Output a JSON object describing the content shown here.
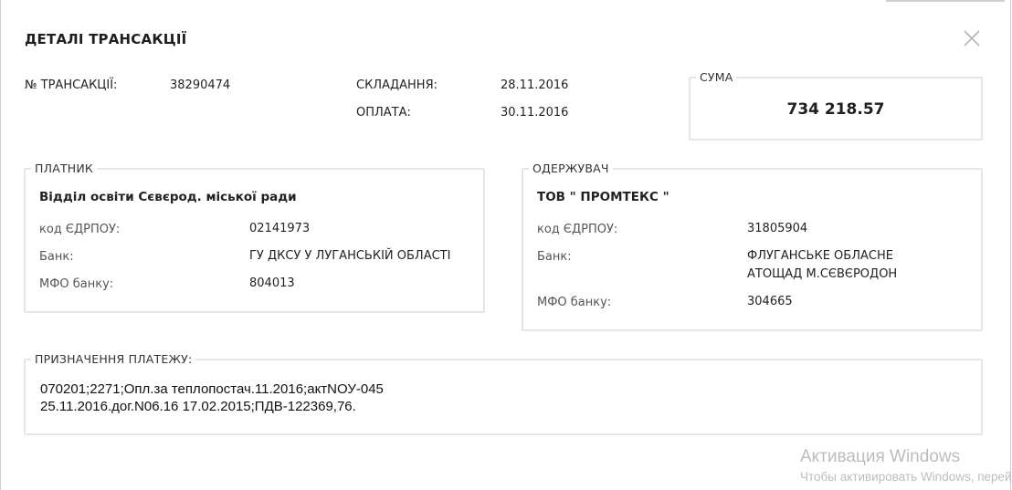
{
  "dialog": {
    "title": "ДЕТАЛІ ТРАНСАКЦІЇ"
  },
  "transaction": {
    "number_label": "№ ТРАНСАКЦІЇ:",
    "number_value": "38290474",
    "compiled_label": "СКЛАДАННЯ:",
    "compiled_value": "28.11.2016",
    "payment_label": "ОПЛАТА:",
    "payment_value": "30.11.2016"
  },
  "sum": {
    "legend": "СУМА",
    "value": "734 218.57"
  },
  "payer": {
    "legend": "ПЛАТНИК",
    "name": "Відділ освіти Сєвєрод. міської ради",
    "edrpou_label": "код ЄДРПОУ:",
    "edrpou_value": "02141973",
    "bank_label": "Банк:",
    "bank_value": "ГУ ДКСУ У ЛУГАНСЬКІЙ ОБЛАСТІ",
    "mfo_label": "МФО банку:",
    "mfo_value": "804013"
  },
  "recipient": {
    "legend": "ОДЕРЖУВАЧ",
    "name": "ТОВ \" ПРОМТЕКС \"",
    "edrpou_label": "код ЄДРПОУ:",
    "edrpou_value": "31805904",
    "bank_label": "Банк:",
    "bank_value_line1": "ФЛУГАНСЬКЕ ОБЛАСНЕ",
    "bank_value_line2": "АТОЩАД М.СЄВЄРОДОН",
    "mfo_label": "МФО банку:",
    "mfo_value": "304665"
  },
  "purpose": {
    "legend": "ПРИЗНАЧЕННЯ ПЛАТЕЖУ:",
    "line1": "070201;2271;Опл.за теплопостач.11.2016;актNОУ-045",
    "line2": "25.11.2016.дог.N06.16 17.02.2015;ПДВ-122369,76."
  },
  "watermark": {
    "title": "Активация Windows",
    "subtitle": "Чтобы активировать Windows, перейдите в раздел «Параметры»."
  }
}
